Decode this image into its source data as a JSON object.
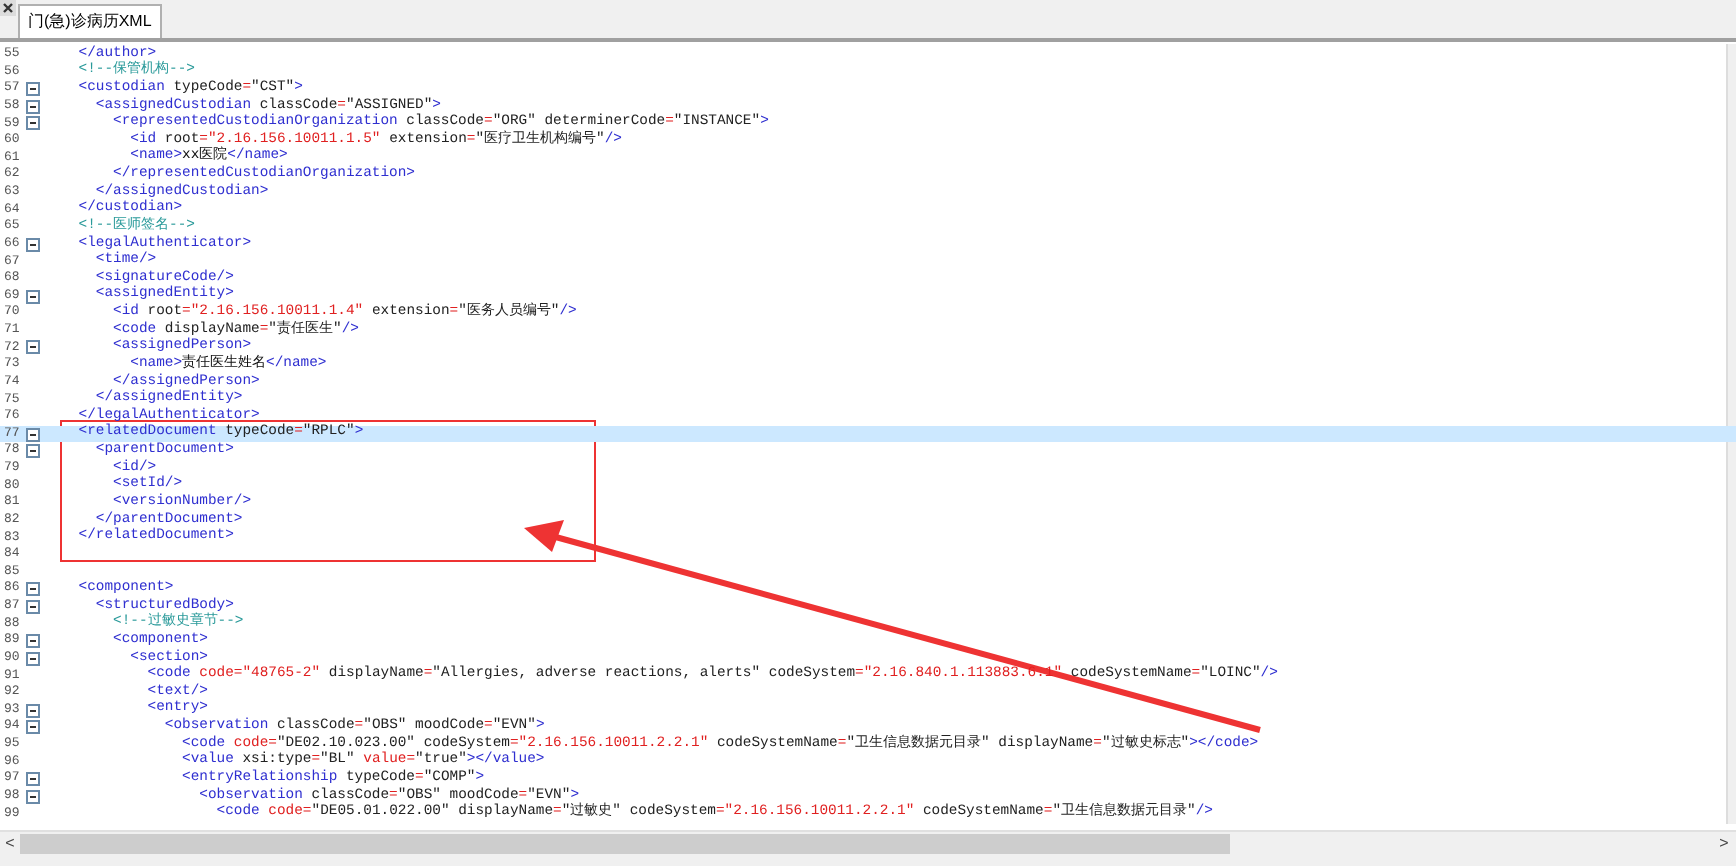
{
  "tab": {
    "label": "门(急)诊病历XML",
    "selected": true
  },
  "lines": [
    {
      "number": "55",
      "fold": false,
      "highlighted": false,
      "tokens": [
        {
          "kind": "tag",
          "text": "    </author>"
        }
      ]
    },
    {
      "number": "56",
      "fold": false,
      "highlighted": false,
      "tokens": [
        {
          "kind": "comment",
          "text": "    <!--保管机构-->"
        }
      ]
    },
    {
      "number": "57",
      "fold": true,
      "highlighted": false,
      "tokens": [
        {
          "kind": "tag",
          "text": "    <custodian"
        },
        {
          "kind": "attr",
          "text": " typeCode"
        },
        {
          "kind": "eq",
          "text": "="
        },
        {
          "kind": "str",
          "text": "\"CST\""
        },
        {
          "kind": "tag",
          "text": ">"
        }
      ]
    },
    {
      "number": "58",
      "fold": true,
      "highlighted": false,
      "tokens": [
        {
          "kind": "tag",
          "text": "      <assignedCustodian"
        },
        {
          "kind": "attr",
          "text": " classCode"
        },
        {
          "kind": "eq",
          "text": "="
        },
        {
          "kind": "str",
          "text": "\"ASSIGNED\""
        },
        {
          "kind": "tag",
          "text": ">"
        }
      ]
    },
    {
      "number": "59",
      "fold": true,
      "highlighted": false,
      "tokens": [
        {
          "kind": "tag",
          "text": "        <representedCustodianOrganization"
        },
        {
          "kind": "attr",
          "text": " classCode"
        },
        {
          "kind": "eq",
          "text": "="
        },
        {
          "kind": "str",
          "text": "\"ORG\""
        },
        {
          "kind": "attr",
          "text": " determinerCode"
        },
        {
          "kind": "eq",
          "text": "="
        },
        {
          "kind": "str",
          "text": "\"INSTANCE\""
        },
        {
          "kind": "tag",
          "text": ">"
        }
      ]
    },
    {
      "number": "60",
      "fold": false,
      "highlighted": false,
      "tokens": [
        {
          "kind": "tag",
          "text": "          <id"
        },
        {
          "kind": "attr",
          "text": " root"
        },
        {
          "kind": "eq",
          "text": "="
        },
        {
          "kind": "num",
          "text": "\"2.16.156.10011.1.5\""
        },
        {
          "kind": "attr",
          "text": " extension"
        },
        {
          "kind": "eq",
          "text": "="
        },
        {
          "kind": "str",
          "text": "\"医疗卫生机构编号\""
        },
        {
          "kind": "tag",
          "text": "/>"
        }
      ]
    },
    {
      "number": "61",
      "fold": false,
      "highlighted": false,
      "tokens": [
        {
          "kind": "tag",
          "text": "          <name>"
        },
        {
          "kind": "text",
          "text": "xx医院"
        },
        {
          "kind": "tag",
          "text": "</name>"
        }
      ]
    },
    {
      "number": "62",
      "fold": false,
      "highlighted": false,
      "tokens": [
        {
          "kind": "tag",
          "text": "        </representedCustodianOrganization>"
        }
      ]
    },
    {
      "number": "63",
      "fold": false,
      "highlighted": false,
      "tokens": [
        {
          "kind": "tag",
          "text": "      </assignedCustodian>"
        }
      ]
    },
    {
      "number": "64",
      "fold": false,
      "highlighted": false,
      "tokens": [
        {
          "kind": "tag",
          "text": "    </custodian>"
        }
      ]
    },
    {
      "number": "65",
      "fold": false,
      "highlighted": false,
      "tokens": [
        {
          "kind": "comment",
          "text": "    <!--医师签名-->"
        }
      ]
    },
    {
      "number": "66",
      "fold": true,
      "highlighted": false,
      "tokens": [
        {
          "kind": "tag",
          "text": "    <legalAuthenticator>"
        }
      ]
    },
    {
      "number": "67",
      "fold": false,
      "highlighted": false,
      "tokens": [
        {
          "kind": "tag",
          "text": "      <time/>"
        }
      ]
    },
    {
      "number": "68",
      "fold": false,
      "highlighted": false,
      "tokens": [
        {
          "kind": "tag",
          "text": "      <signatureCode/>"
        }
      ]
    },
    {
      "number": "69",
      "fold": true,
      "highlighted": false,
      "tokens": [
        {
          "kind": "tag",
          "text": "      <assignedEntity>"
        }
      ]
    },
    {
      "number": "70",
      "fold": false,
      "highlighted": false,
      "tokens": [
        {
          "kind": "tag",
          "text": "        <id"
        },
        {
          "kind": "attr",
          "text": " root"
        },
        {
          "kind": "eq",
          "text": "="
        },
        {
          "kind": "num",
          "text": "\"2.16.156.10011.1.4\""
        },
        {
          "kind": "attr",
          "text": " extension"
        },
        {
          "kind": "eq",
          "text": "="
        },
        {
          "kind": "str",
          "text": "\"医务人员编号\""
        },
        {
          "kind": "tag",
          "text": "/>"
        }
      ]
    },
    {
      "number": "71",
      "fold": false,
      "highlighted": false,
      "tokens": [
        {
          "kind": "tag",
          "text": "        <code"
        },
        {
          "kind": "attr",
          "text": " displayName"
        },
        {
          "kind": "eq",
          "text": "="
        },
        {
          "kind": "str",
          "text": "\"责任医生\""
        },
        {
          "kind": "tag",
          "text": "/>"
        }
      ]
    },
    {
      "number": "72",
      "fold": true,
      "highlighted": false,
      "tokens": [
        {
          "kind": "tag",
          "text": "        <assignedPerson>"
        }
      ]
    },
    {
      "number": "73",
      "fold": false,
      "highlighted": false,
      "tokens": [
        {
          "kind": "tag",
          "text": "          <name>"
        },
        {
          "kind": "text",
          "text": "责任医生姓名"
        },
        {
          "kind": "tag",
          "text": "</name>"
        }
      ]
    },
    {
      "number": "74",
      "fold": false,
      "highlighted": false,
      "tokens": [
        {
          "kind": "tag",
          "text": "        </assignedPerson>"
        }
      ]
    },
    {
      "number": "75",
      "fold": false,
      "highlighted": false,
      "tokens": [
        {
          "kind": "tag",
          "text": "      </assignedEntity>"
        }
      ]
    },
    {
      "number": "76",
      "fold": false,
      "highlighted": false,
      "tokens": [
        {
          "kind": "tag",
          "text": "    </legalAuthenticator>"
        }
      ]
    },
    {
      "number": "77",
      "fold": true,
      "highlighted": true,
      "tokens": [
        {
          "kind": "tag",
          "text": "    <relatedDocument"
        },
        {
          "kind": "attr",
          "text": " typeCode"
        },
        {
          "kind": "eq",
          "text": "="
        },
        {
          "kind": "str",
          "text": "\"RPLC\""
        },
        {
          "kind": "tag",
          "text": ">"
        }
      ]
    },
    {
      "number": "78",
      "fold": true,
      "highlighted": false,
      "tokens": [
        {
          "kind": "tag",
          "text": "      <parentDocument>"
        }
      ]
    },
    {
      "number": "79",
      "fold": false,
      "highlighted": false,
      "tokens": [
        {
          "kind": "tag",
          "text": "        <id/>"
        }
      ]
    },
    {
      "number": "80",
      "fold": false,
      "highlighted": false,
      "tokens": [
        {
          "kind": "tag",
          "text": "        <setId/>"
        }
      ]
    },
    {
      "number": "81",
      "fold": false,
      "highlighted": false,
      "tokens": [
        {
          "kind": "tag",
          "text": "        <versionNumber/>"
        }
      ]
    },
    {
      "number": "82",
      "fold": false,
      "highlighted": false,
      "tokens": [
        {
          "kind": "tag",
          "text": "      </parentDocument>"
        }
      ]
    },
    {
      "number": "83",
      "fold": false,
      "highlighted": false,
      "tokens": [
        {
          "kind": "tag",
          "text": "    </relatedDocument>"
        }
      ]
    },
    {
      "number": "84",
      "fold": false,
      "highlighted": false
    },
    {
      "number": "85",
      "fold": false,
      "highlighted": false
    },
    {
      "number": "86",
      "fold": true,
      "highlighted": false,
      "tokens": [
        {
          "kind": "tag",
          "text": "    <component>"
        }
      ]
    },
    {
      "number": "87",
      "fold": true,
      "highlighted": false,
      "tokens": [
        {
          "kind": "tag",
          "text": "      <structuredBody>"
        }
      ]
    },
    {
      "number": "88",
      "fold": false,
      "highlighted": false,
      "tokens": [
        {
          "kind": "comment",
          "text": "        <!--过敏史章节-->"
        }
      ]
    },
    {
      "number": "89",
      "fold": true,
      "highlighted": false,
      "tokens": [
        {
          "kind": "tag",
          "text": "        <component>"
        }
      ]
    },
    {
      "number": "90",
      "fold": true,
      "highlighted": false,
      "tokens": [
        {
          "kind": "tag",
          "text": "          <section>"
        }
      ]
    },
    {
      "number": "91",
      "fold": false,
      "highlighted": false,
      "tokens": [
        {
          "kind": "tag",
          "text": "            <code"
        },
        {
          "kind": "attr_alt",
          "text": " code"
        },
        {
          "kind": "eq",
          "text": "="
        },
        {
          "kind": "num",
          "text": "\"48765-2\""
        },
        {
          "kind": "attr",
          "text": " displayName"
        },
        {
          "kind": "eq",
          "text": "="
        },
        {
          "kind": "str",
          "text": "\"Allergies, adverse reactions, alerts\""
        },
        {
          "kind": "attr",
          "text": " codeSystem"
        },
        {
          "kind": "eq",
          "text": "="
        },
        {
          "kind": "num",
          "text": "\"2.16.840.1.113883.6.1\""
        },
        {
          "kind": "attr",
          "text": " codeSystemName"
        },
        {
          "kind": "eq",
          "text": "="
        },
        {
          "kind": "str",
          "text": "\"LOINC\""
        },
        {
          "kind": "tag",
          "text": "/>"
        }
      ]
    },
    {
      "number": "92",
      "fold": false,
      "highlighted": false,
      "tokens": [
        {
          "kind": "tag",
          "text": "            <text/>"
        }
      ]
    },
    {
      "number": "93",
      "fold": true,
      "highlighted": false,
      "tokens": [
        {
          "kind": "tag",
          "text": "            <entry>"
        }
      ]
    },
    {
      "number": "94",
      "fold": true,
      "highlighted": false,
      "tokens": [
        {
          "kind": "tag",
          "text": "              <observation"
        },
        {
          "kind": "attr",
          "text": " classCode"
        },
        {
          "kind": "eq",
          "text": "="
        },
        {
          "kind": "str",
          "text": "\"OBS\""
        },
        {
          "kind": "attr",
          "text": " moodCode"
        },
        {
          "kind": "eq",
          "text": "="
        },
        {
          "kind": "str",
          "text": "\"EVN\""
        },
        {
          "kind": "tag",
          "text": ">"
        }
      ]
    },
    {
      "number": "95",
      "fold": false,
      "highlighted": false,
      "tokens": [
        {
          "kind": "tag",
          "text": "                <code"
        },
        {
          "kind": "attr_alt",
          "text": " code"
        },
        {
          "kind": "eq",
          "text": "="
        },
        {
          "kind": "str",
          "text": "\"DE02.10.023.00\""
        },
        {
          "kind": "attr",
          "text": " codeSystem"
        },
        {
          "kind": "eq",
          "text": "="
        },
        {
          "kind": "num",
          "text": "\"2.16.156.10011.2.2.1\""
        },
        {
          "kind": "attr",
          "text": " codeSystemName"
        },
        {
          "kind": "eq",
          "text": "="
        },
        {
          "kind": "str",
          "text": "\"卫生信息数据元目录\""
        },
        {
          "kind": "attr",
          "text": " displayName"
        },
        {
          "kind": "eq",
          "text": "="
        },
        {
          "kind": "str",
          "text": "\"过敏史标志\""
        },
        {
          "kind": "tag",
          "text": "></code>"
        }
      ]
    },
    {
      "number": "96",
      "fold": false,
      "highlighted": false,
      "tokens": [
        {
          "kind": "tag",
          "text": "                <value"
        },
        {
          "kind": "attr",
          "text": " xsi:type"
        },
        {
          "kind": "eq",
          "text": "="
        },
        {
          "kind": "str",
          "text": "\"BL\""
        },
        {
          "kind": "attr_alt",
          "text": " value"
        },
        {
          "kind": "eq",
          "text": "="
        },
        {
          "kind": "str",
          "text": "\"true\""
        },
        {
          "kind": "tag",
          "text": "></value>"
        }
      ]
    },
    {
      "number": "97",
      "fold": true,
      "highlighted": false,
      "tokens": [
        {
          "kind": "tag",
          "text": "                <entryRelationship"
        },
        {
          "kind": "attr",
          "text": " typeCode"
        },
        {
          "kind": "eq",
          "text": "="
        },
        {
          "kind": "str",
          "text": "\"COMP\""
        },
        {
          "kind": "tag",
          "text": ">"
        }
      ]
    },
    {
      "number": "98",
      "fold": true,
      "highlighted": false,
      "tokens": [
        {
          "kind": "tag",
          "text": "                  <observation"
        },
        {
          "kind": "attr",
          "text": " classCode"
        },
        {
          "kind": "eq",
          "text": "="
        },
        {
          "kind": "str",
          "text": "\"OBS\""
        },
        {
          "kind": "attr",
          "text": " moodCode"
        },
        {
          "kind": "eq",
          "text": "="
        },
        {
          "kind": "str",
          "text": "\"EVN\""
        },
        {
          "kind": "tag",
          "text": ">"
        }
      ]
    },
    {
      "number": "99",
      "fold": false,
      "highlighted": false,
      "tokens": [
        {
          "kind": "tag",
          "text": "                    <code"
        },
        {
          "kind": "attr_alt",
          "text": " code"
        },
        {
          "kind": "eq",
          "text": "="
        },
        {
          "kind": "str",
          "text": "\"DE05.01.022.00\""
        },
        {
          "kind": "attr",
          "text": " displayName"
        },
        {
          "kind": "eq",
          "text": "="
        },
        {
          "kind": "str",
          "text": "\"过敏史\""
        },
        {
          "kind": "attr",
          "text": " codeSystem"
        },
        {
          "kind": "eq",
          "text": "="
        },
        {
          "kind": "num",
          "text": "\"2.16.156.10011.2.2.1\""
        },
        {
          "kind": "attr",
          "text": " codeSystemName"
        },
        {
          "kind": "eq",
          "text": "="
        },
        {
          "kind": "str",
          "text": "\"卫生信息数据元目录\""
        },
        {
          "kind": "tag",
          "text": "/>"
        }
      ]
    }
  ],
  "scrollbar": {
    "left_arrow": "<",
    "right_arrow": ">"
  }
}
